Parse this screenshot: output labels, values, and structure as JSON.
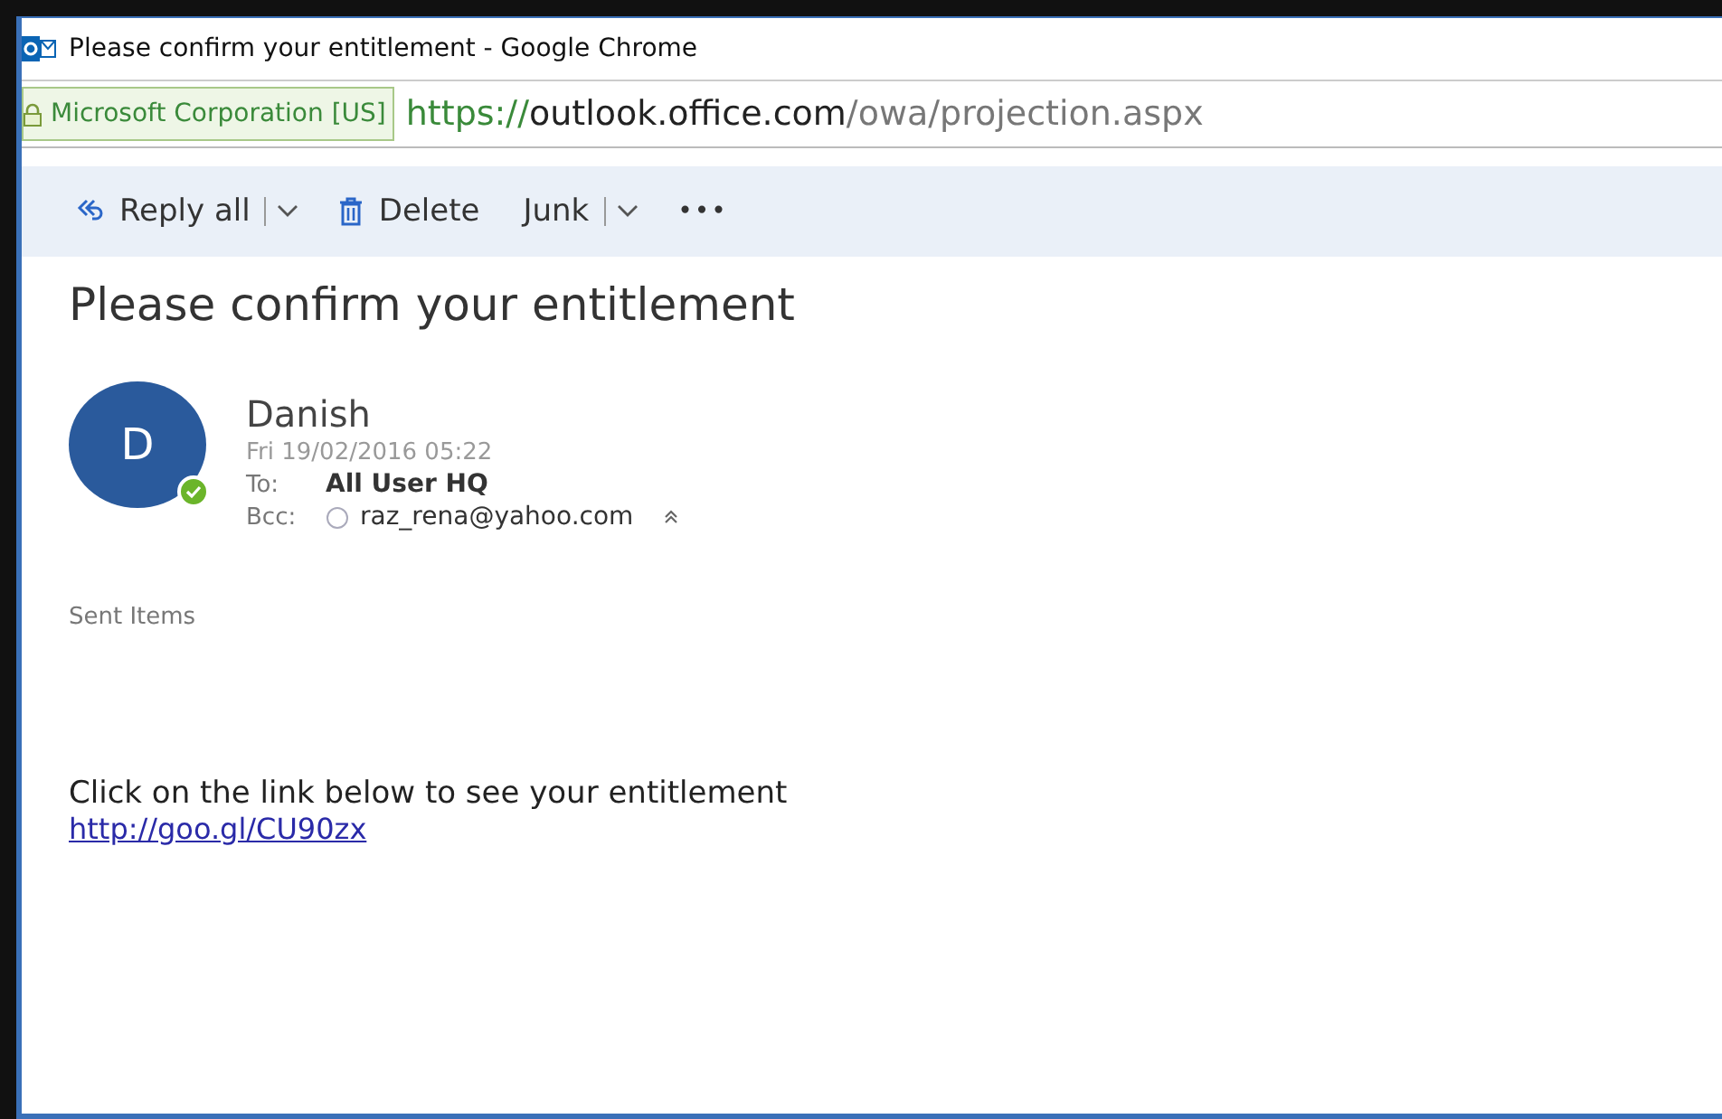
{
  "window": {
    "title": "Please confirm your entitlement - Google Chrome"
  },
  "address_bar": {
    "certificate": "Microsoft Corporation [US]",
    "url_scheme": "https://",
    "url_host": "outlook.office.com",
    "url_path": "/owa/projection.aspx"
  },
  "toolbar": [
    {
      "kind": "reply",
      "label": "Reply all",
      "caret": true
    },
    {
      "kind": "delete",
      "label": "Delete",
      "caret": false
    },
    {
      "kind": "plain",
      "label": "Junk",
      "caret": true
    },
    {
      "kind": "more",
      "label": "•••",
      "caret": false
    }
  ],
  "message": {
    "subject": "Please confirm your entitlement",
    "avatar_letter": "D",
    "sender": "Danish",
    "date": "Fri 19/02/2016 05:22",
    "to_label": "To:",
    "to": "All User HQ",
    "bcc_label": "Bcc:",
    "bcc": "raz_rena@yahoo.com",
    "folder": "Sent Items",
    "body": "Click on the link below to see your entitlement",
    "link": "http://goo.gl/CU90zx"
  }
}
